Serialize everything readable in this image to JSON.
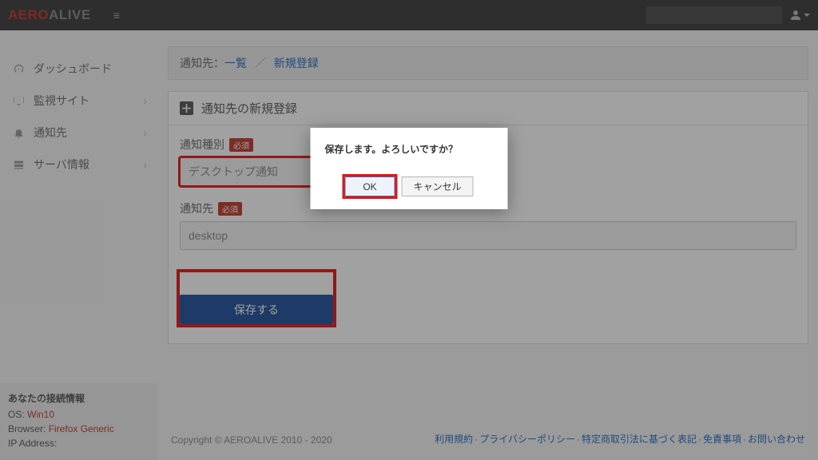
{
  "brand": {
    "part1": "AERO",
    "part2": "ALIVE"
  },
  "sidebar": {
    "items": [
      {
        "label": "ダッシュボード",
        "expandable": false
      },
      {
        "label": "監視サイト",
        "expandable": true
      },
      {
        "label": "通知先",
        "expandable": true
      },
      {
        "label": "サーバ情報",
        "expandable": true
      }
    ],
    "connection": {
      "title": "あなたの接続情報",
      "os_label": "OS:",
      "os_value": "Win10",
      "browser_label": "Browser:",
      "browser_value": "Firefox Generic",
      "ip_label": "IP Address:"
    }
  },
  "breadcrumb": {
    "prefix": "通知先：",
    "link1": "一覧",
    "current": "新規登録"
  },
  "panel": {
    "title": "通知先の新規登録",
    "required_badge": "必須",
    "field1_label": "通知種別",
    "field1_value": "デスクトップ通知",
    "field2_label": "通知先",
    "field2_value": "desktop",
    "save_label": "保存する"
  },
  "modal": {
    "message": "保存します。よろしいですか？",
    "ok": "OK",
    "cancel": "キャンセル"
  },
  "footer": {
    "copyright": "Copyright © AEROALIVE 2010 - 2020",
    "links": [
      "利用規約",
      "プライバシーポリシー",
      "特定商取引法に基づく表記",
      "免責事項",
      "お問い合わせ"
    ]
  }
}
